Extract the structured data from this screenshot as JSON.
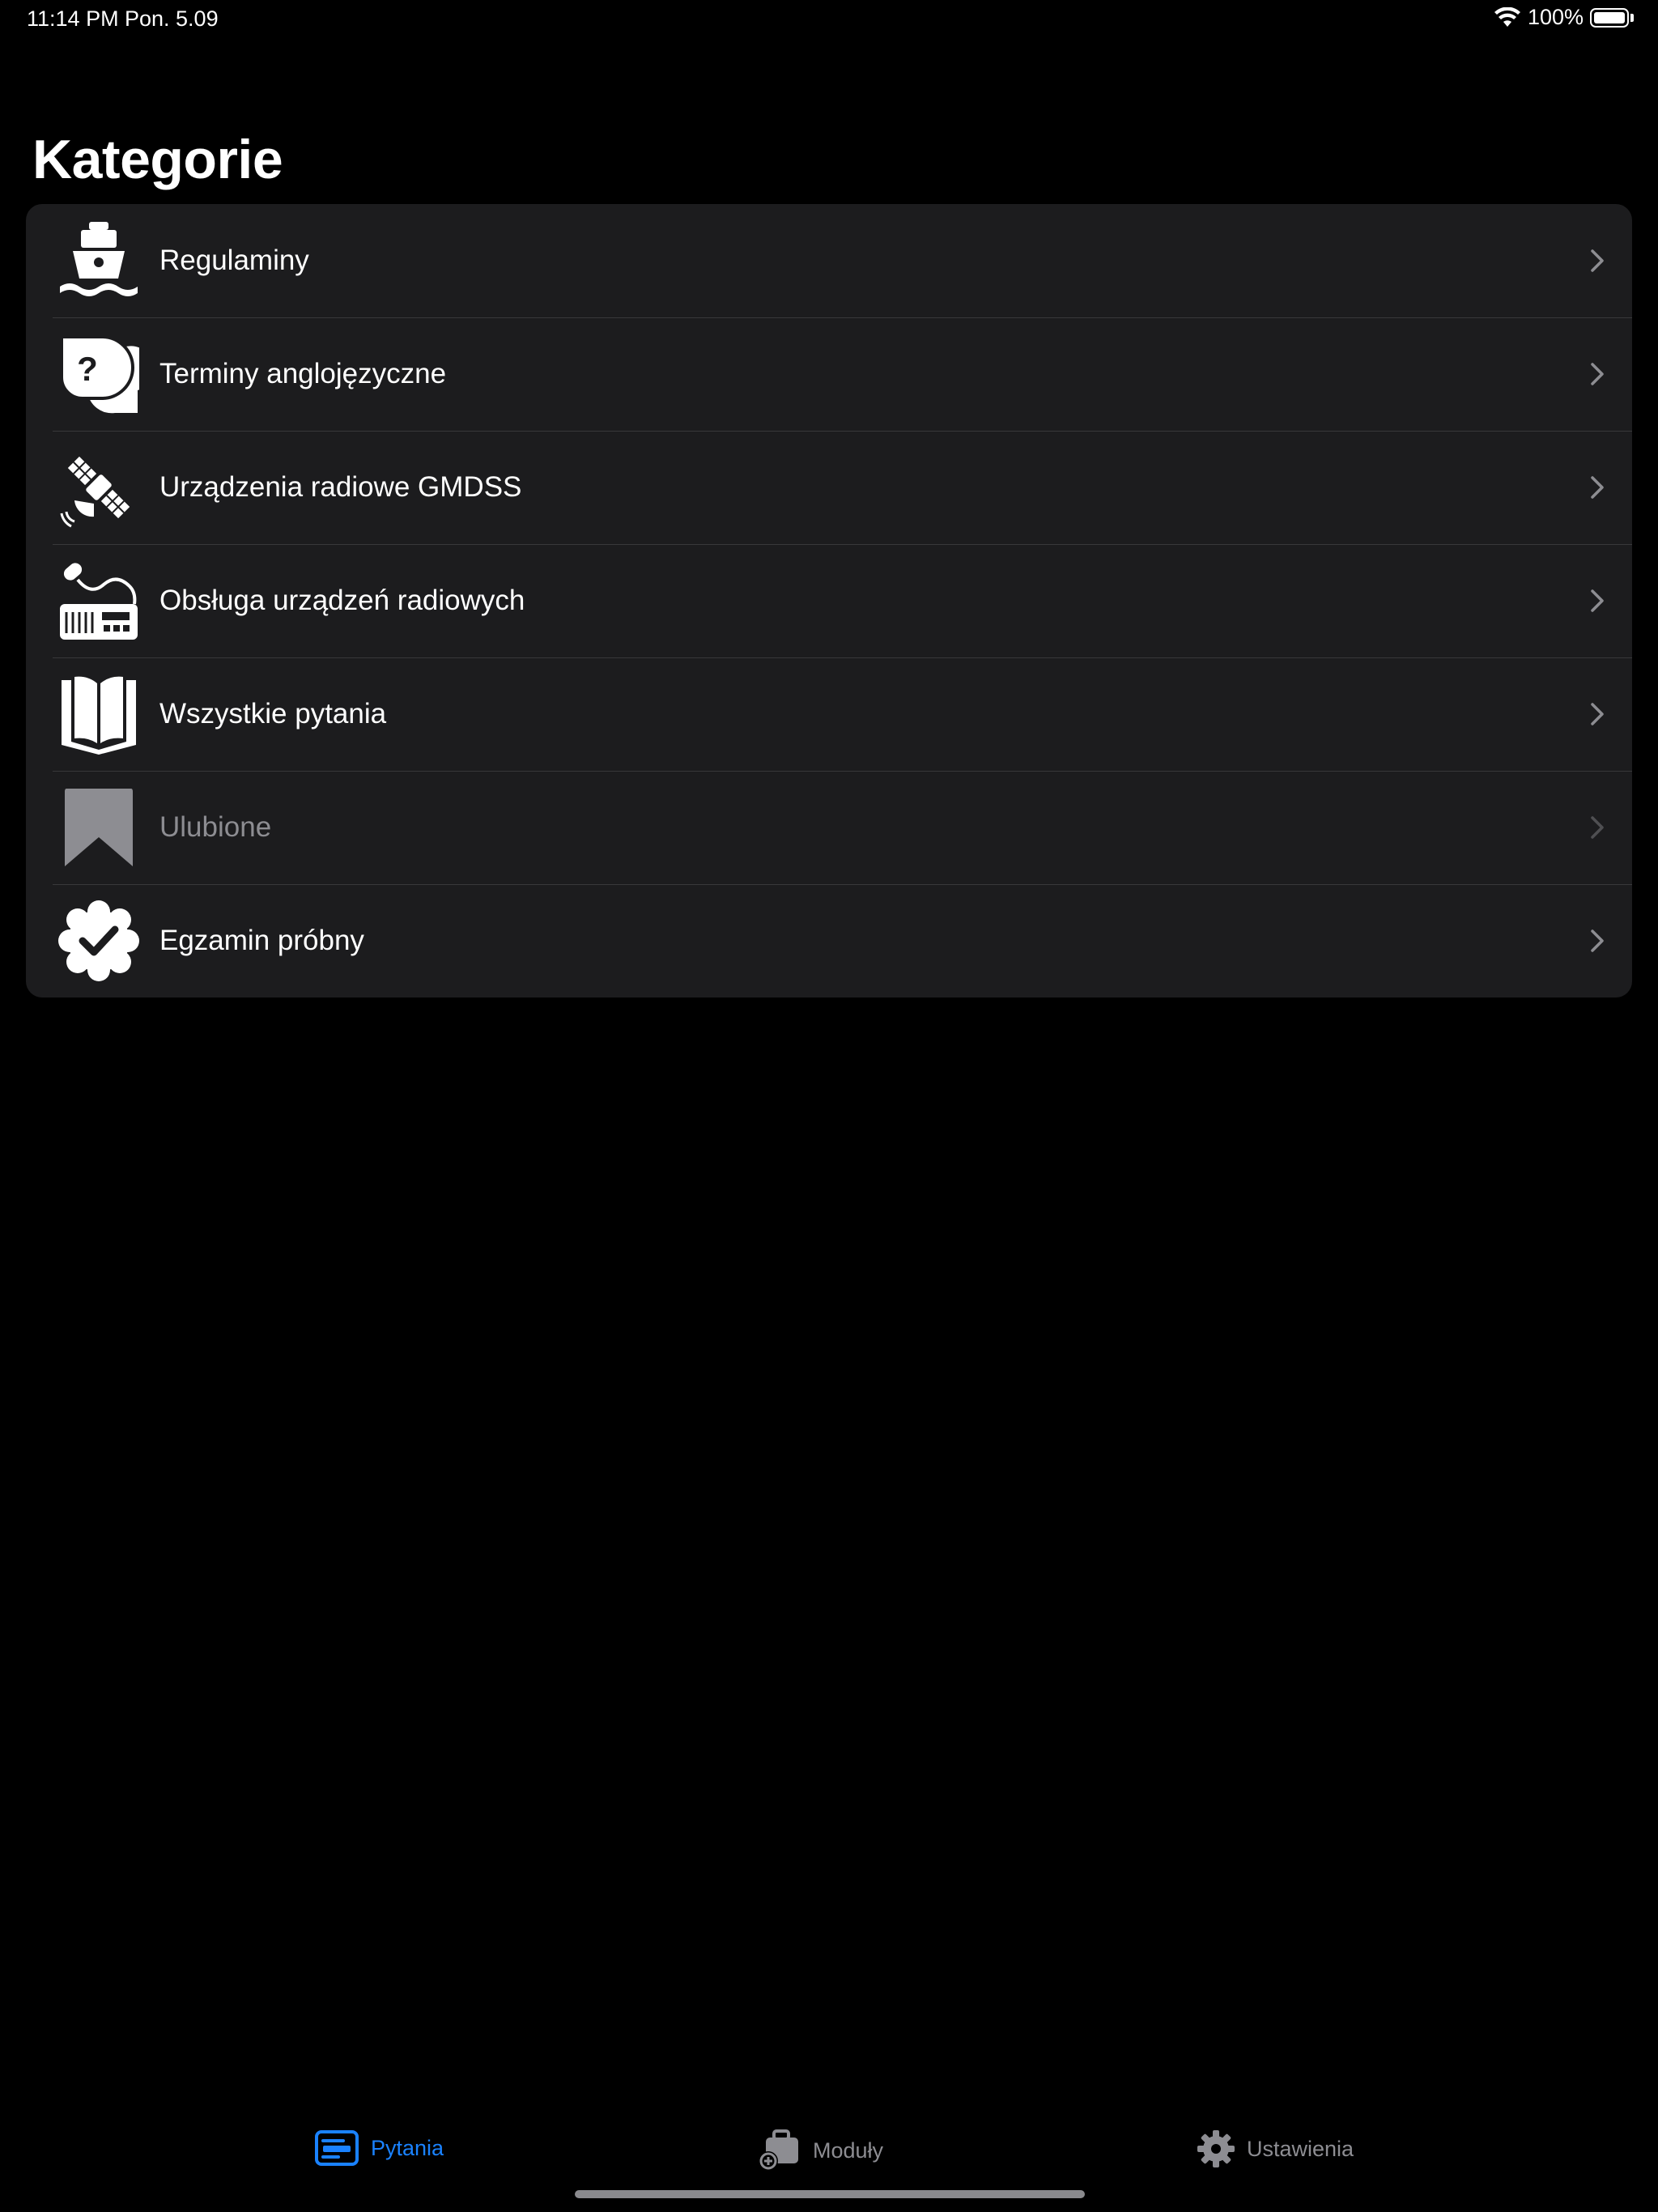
{
  "status": {
    "time": "11:14 PM",
    "date": "Pon. 5.09",
    "battery": "100%"
  },
  "header": {
    "title": "Kategorie"
  },
  "categories": [
    {
      "label": "Regulaminy",
      "icon": "ship-icon",
      "enabled": true
    },
    {
      "label": "Terminy anglojęzyczne",
      "icon": "question-bubbles-icon",
      "enabled": true
    },
    {
      "label": "Urządzenia radiowe GMDSS",
      "icon": "satellite-icon",
      "enabled": true
    },
    {
      "label": "Obsługa urządzeń radiowych",
      "icon": "radio-microphone-icon",
      "enabled": true
    },
    {
      "label": "Wszystkie pytania",
      "icon": "open-book-icon",
      "enabled": true
    },
    {
      "label": "Ulubione",
      "icon": "bookmark-icon",
      "enabled": false
    },
    {
      "label": "Egzamin próbny",
      "icon": "badge-check-icon",
      "enabled": true
    }
  ],
  "tabs": [
    {
      "label": "Pytania",
      "icon": "questions-list-icon",
      "active": true
    },
    {
      "label": "Moduły",
      "icon": "briefcase-add-icon",
      "active": false
    },
    {
      "label": "Ustawienia",
      "icon": "gear-icon",
      "active": false
    }
  ],
  "colors": {
    "accent": "#1a82ff",
    "background": "#000000",
    "list_bg": "#1c1c1e",
    "disabled": "#8d8d92"
  }
}
